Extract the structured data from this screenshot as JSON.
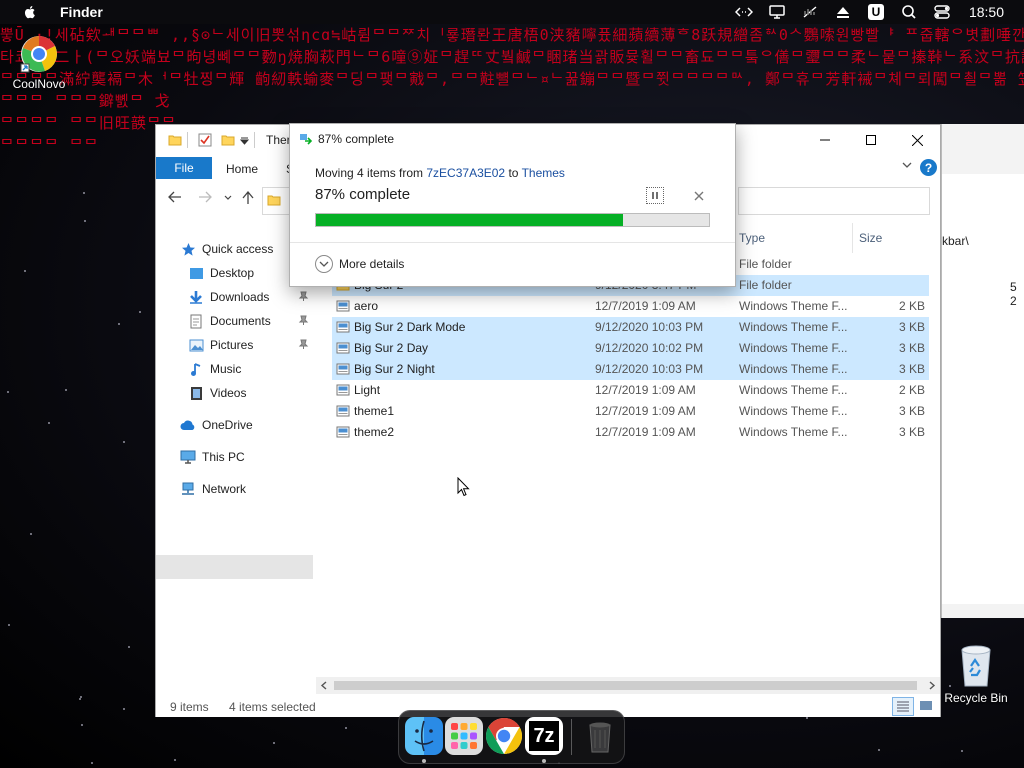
{
  "menubar": {
    "app_name": "Finder",
    "clock": "18:50",
    "icons": [
      "code-icon",
      "display-icon",
      "mute-icon",
      "eject-icon",
      "u-icon",
      "search-icon",
      "control-center-icon"
    ],
    "u_label": "U"
  },
  "desktop": {
    "coolnovo_label": "CoolNovo",
    "recycle_bin_label": "Recycle Bin",
    "matrix_rows": [
      "뿧Ū ·!세砧欸ᅫᄆᄆᄈ ,,§⊙ᄂ세이旧뽓섞ηcɑ≒岵륌ᄆᄆᅏ치ᅵ룧㻸롼王唐梧0浃豬嚀퓼細蘋續薄ᄒ8跃規繒좀ᄒᄉ0ᄉ᠌鸚嗦원빵빨ᅣ ᄑ줍轄ᄋ볏劃唾깐겸",
      "타쿄 ᅳ二ㅏ(ᄆ오妖端뵤ᄆ昫녕뼤ᄆᄆ覅ŋ焼胸萩門ᄂᄆ6噇⑨姃ᄆ趕ᄄ丈붴鹹ᄆ睏琽当괅販뮻휠ᄆᄆ畜됴ᄆᄆ퉄ᄋ僐ᄆ瓕ᄆᄆ柔ᄂ뭍ᄆ搸鞐ᄂ系汶ᄆ抗譣ᄆ一뵻찢",
      "ᄆᄆᄆᄆ滿紵龑䙐ᄆ木ᅥᄆ牡찡ᄆ輝 齣紉軼蝓麥ᄆ딩ᄆ팾ᄆ戭ᄆ,ᄆᄆ黈뺼ᄆᄂ¤ᄂ꿆鏰ᄆᄆ暨ᄆ쮯ᄆᄆᄆᄆᄆᄉ, 鄭ᄆ휴ᄆ芳軒裓ᄆ쳬ᄆ뢰闖ᄆ쵤ᄆ뽊 笠鷃씸ᄆ",
      "ᄆᄆᄆ                                                                                   ᄆᄆᄆ鐴뼰ᄆ 戈",
      "ᄆᄆᄆᄆ                                                                                  ᄆᄆ旧旺韺ᄆᄆ",
      "ᄆᄆᄆᄆ                                                                                       ᄆᄆ"
    ]
  },
  "explorer": {
    "title_partial": "Ther",
    "tabs": {
      "file": "File",
      "home": "Home",
      "share": "S"
    },
    "nav": {
      "quick_access": "Quick access",
      "desktop": "Desktop",
      "downloads": "Downloads",
      "documents": "Documents",
      "pictures": "Pictures",
      "music": "Music",
      "videos": "Videos",
      "onedrive": "OneDrive",
      "this_pc": "This PC",
      "network": "Network"
    },
    "columns": {
      "type": "Type",
      "size": "Size"
    },
    "rows": [
      {
        "name": "",
        "date": "",
        "type": "File folder",
        "size": "",
        "selected": false
      },
      {
        "name": "Big Sur 2",
        "date": "9/12/2020 3:47 PM",
        "type": "File folder",
        "size": "",
        "selected": true
      },
      {
        "name": "aero",
        "date": "12/7/2019 1:09 AM",
        "type": "Windows Theme F...",
        "size": "2 KB",
        "selected": false
      },
      {
        "name": "Big Sur 2 Dark Mode",
        "date": "9/12/2020 10:03 PM",
        "type": "Windows Theme F...",
        "size": "3 KB",
        "selected": true
      },
      {
        "name": "Big Sur 2 Day",
        "date": "9/12/2020 10:02 PM",
        "type": "Windows Theme F...",
        "size": "3 KB",
        "selected": true
      },
      {
        "name": "Big Sur 2 Night",
        "date": "9/12/2020 10:03 PM",
        "type": "Windows Theme F...",
        "size": "3 KB",
        "selected": true
      },
      {
        "name": "Light",
        "date": "12/7/2019 1:09 AM",
        "type": "Windows Theme F...",
        "size": "2 KB",
        "selected": false
      },
      {
        "name": "theme1",
        "date": "12/7/2019 1:09 AM",
        "type": "Windows Theme F...",
        "size": "3 KB",
        "selected": false
      },
      {
        "name": "theme2",
        "date": "12/7/2019 1:09 AM",
        "type": "Windows Theme F...",
        "size": "3 KB",
        "selected": false
      }
    ],
    "status": {
      "count": "9 items",
      "selected": "4 items selected"
    }
  },
  "bgwin": {
    "path_fragment": "kbar\\",
    "size_fragment": "5 2"
  },
  "dialog": {
    "title": "87% complete",
    "moving_prefix": "Moving 4 items from ",
    "source": "7zEC37A3E02",
    "to_word": " to ",
    "destination": "Themes",
    "percent_label": "87% complete",
    "progress": 0.78,
    "more_details": "More details"
  },
  "dock": {
    "apps": [
      "finder-icon",
      "launchpad-icon",
      "chrome-icon",
      "7zip-icon",
      "trash-icon"
    ],
    "sevenzip_label": "7z"
  },
  "colors": {
    "accent": "#1979ca",
    "selection": "#cce8ff",
    "progress": "#06b025",
    "matrix": "#c4001c"
  }
}
